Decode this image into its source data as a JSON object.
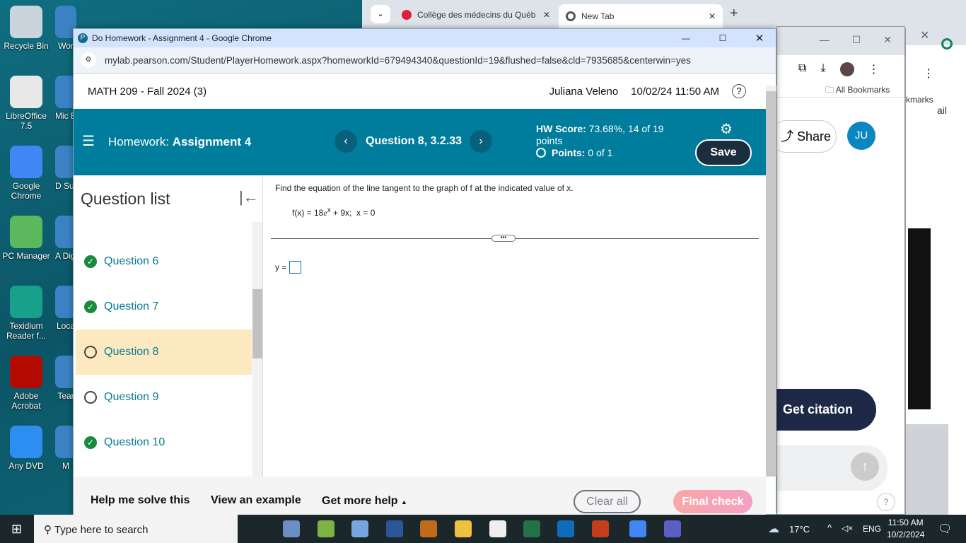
{
  "desktop": {
    "icons": [
      {
        "label": "Recycle Bin",
        "color": "#c9d4dc"
      },
      {
        "label": "LibreOffice 7.5",
        "color": "#e8e8e8"
      },
      {
        "label": "Google Chrome",
        "color": "#4285f4"
      },
      {
        "label": "PC Manager",
        "color": "#5cb85c"
      },
      {
        "label": "Texidium Reader f...",
        "color": "#17a08a"
      },
      {
        "label": "Adobe Acrobat",
        "color": "#b30b00"
      },
      {
        "label": "Any DVD",
        "color": "#2b8ef0"
      }
    ],
    "partial_icons": [
      "Wor",
      "Mic E",
      "D Supp",
      "A Digi",
      "Loca",
      "Tear",
      "M"
    ]
  },
  "back_browser": {
    "tabs": [
      {
        "label": "Collège des médecins du Québ",
        "icon": "cmq-icon"
      },
      {
        "label": "New Tab",
        "icon": "chrome-icon"
      }
    ],
    "bookmarks_label": "All Bookmarks",
    "bookmarks_partial": "kmarks",
    "partial_text": "ail",
    "share_label": "Share",
    "avatar": "JU",
    "citation_label": "Get citation"
  },
  "window": {
    "title": "Do Homework - Assignment 4 - Google Chrome",
    "url": "mylab.pearson.com/Student/PlayerHomework.aspx?homeworkId=679494340&questionId=19&flushed=false&cld=7935685&centerwin=yes"
  },
  "header": {
    "course": "MATH 209 - Fall 2024 (3)",
    "user": "Juliana Veleno",
    "datetime": "10/02/24 11:50 AM"
  },
  "band": {
    "homework_label": "Homework:",
    "assignment": "Assignment 4",
    "question": "Question 8, 3.2.33",
    "hw_score_label": "HW Score:",
    "hw_score": "73.68%, 14 of 19",
    "hw_score_unit": "points",
    "points_label": "Points:",
    "points": "0 of 1",
    "save": "Save",
    "accent": "#007c9c"
  },
  "question_list": {
    "title": "Question list",
    "items": [
      {
        "label": "Question 6",
        "status": "complete"
      },
      {
        "label": "Question 7",
        "status": "complete"
      },
      {
        "label": "Question 8",
        "status": "current"
      },
      {
        "label": "Question 9",
        "status": "incomplete"
      },
      {
        "label": "Question 10",
        "status": "complete"
      }
    ]
  },
  "problem": {
    "prompt": "Find the equation of the line tangent to the graph of f at the indicated value of x.",
    "fx_left": "f(x) = 18",
    "e": "e",
    "exp": "x",
    "fx_right": " + 9x;  x = 0",
    "answer_label": "y =",
    "answer_value": ""
  },
  "footer": {
    "help": "Help me solve this",
    "example": "View an example",
    "more": "Get more help",
    "clear": "Clear all",
    "final": "Final check"
  },
  "taskbar": {
    "search": "Type here to search",
    "weather": "17°C",
    "lang": "ENG",
    "time": "11:50 AM",
    "date": "10/2/2024"
  }
}
